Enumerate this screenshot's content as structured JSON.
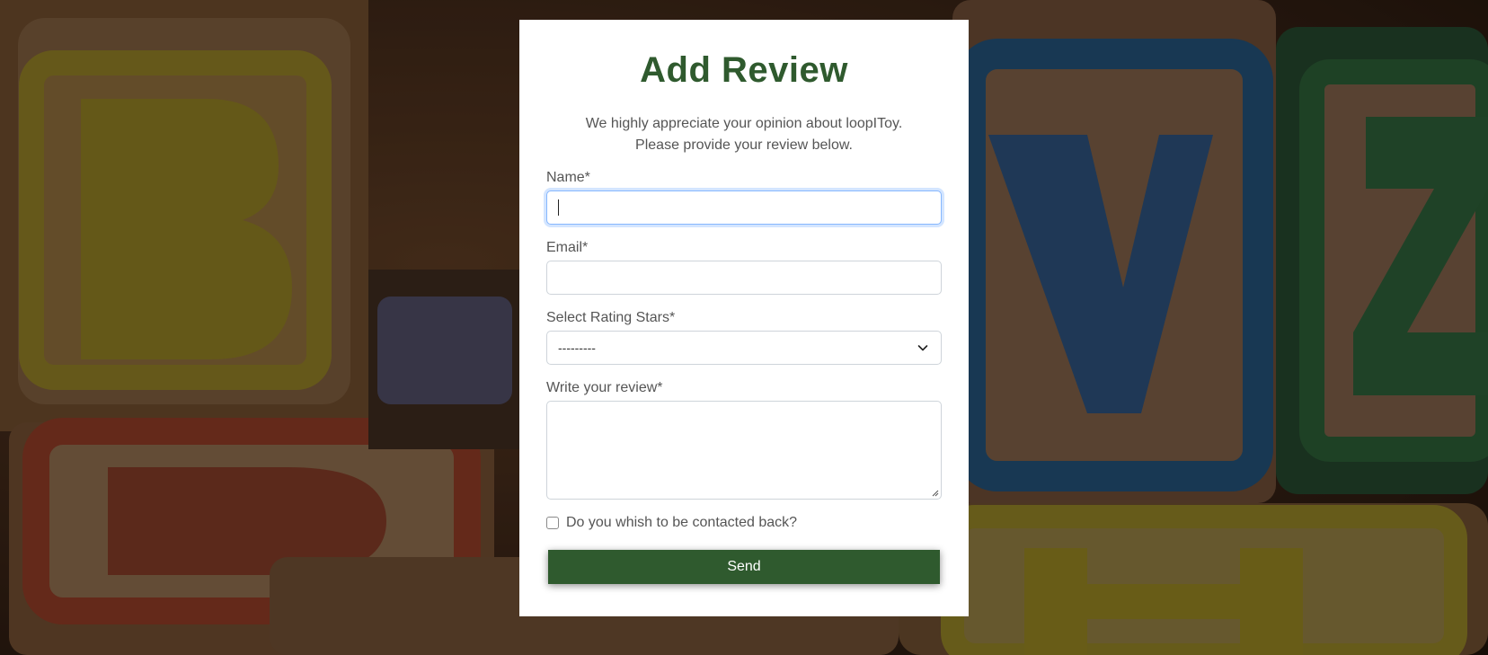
{
  "form": {
    "title": "Add Review",
    "intro": "We highly appreciate your opinion about loopIToy. Please provide your review below.",
    "name_label": "Name*",
    "name_value": "",
    "email_label": "Email*",
    "email_value": "",
    "rating_label": "Select Rating Stars*",
    "rating_selected": "---------",
    "review_label": "Write your review*",
    "review_value": "",
    "contact_label": "Do you whish to be contacted back?",
    "contact_checked": false,
    "send_label": "Send"
  },
  "colors": {
    "accent": "#2f5a2e",
    "focus_border": "#86b7fe",
    "text": "#555555"
  },
  "icons": {
    "select_arrow": "chevron-down-icon",
    "textarea_resize": "resize-grip-icon"
  }
}
